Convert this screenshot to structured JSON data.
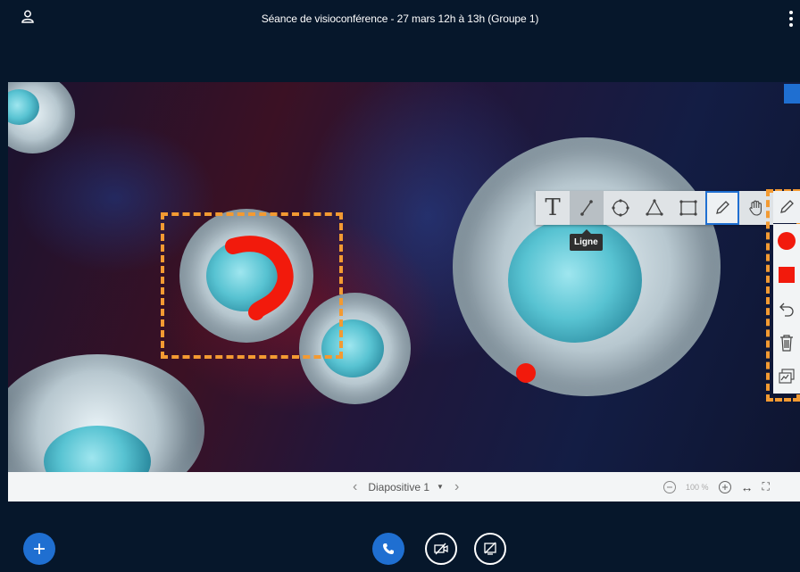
{
  "header": {
    "title": "Séance de visioconférence - 27 mars 12h à 13h (Groupe 1)",
    "user_icon": "user-icon",
    "menu_icon": "kebab-menu-icon"
  },
  "whiteboard_toolbar": {
    "tools": [
      {
        "name": "text",
        "icon": "text-icon"
      },
      {
        "name": "line",
        "icon": "line-icon",
        "active": true
      },
      {
        "name": "ellipse",
        "icon": "ellipse-icon"
      },
      {
        "name": "triangle",
        "icon": "triangle-icon"
      },
      {
        "name": "rectangle",
        "icon": "rectangle-icon"
      },
      {
        "name": "pencil",
        "icon": "pencil-icon",
        "selected": true
      },
      {
        "name": "pan",
        "icon": "hand-icon"
      }
    ],
    "tooltip": "Ligne"
  },
  "side_toolbar": {
    "tools": [
      "pencil-icon",
      "color-circle-icon",
      "fill-square-icon",
      "undo-icon",
      "trash-icon",
      "multi-user-icon"
    ],
    "color": "#f21a0c",
    "accent": "#1f6fd1"
  },
  "presentation": {
    "slide_label": "Diapositive 1",
    "dropdown_icon": "caret-down-icon",
    "zoom_level": "100 %"
  },
  "actions": {
    "add_icon": "plus-icon",
    "phone_icon": "phone-icon",
    "camera_off_icon": "camera-off-icon",
    "screen_share_off_icon": "screen-share-off-icon"
  },
  "colors": {
    "background": "#06172b",
    "highlight_orange": "#f39a32",
    "primary_blue": "#1f6fd1"
  }
}
